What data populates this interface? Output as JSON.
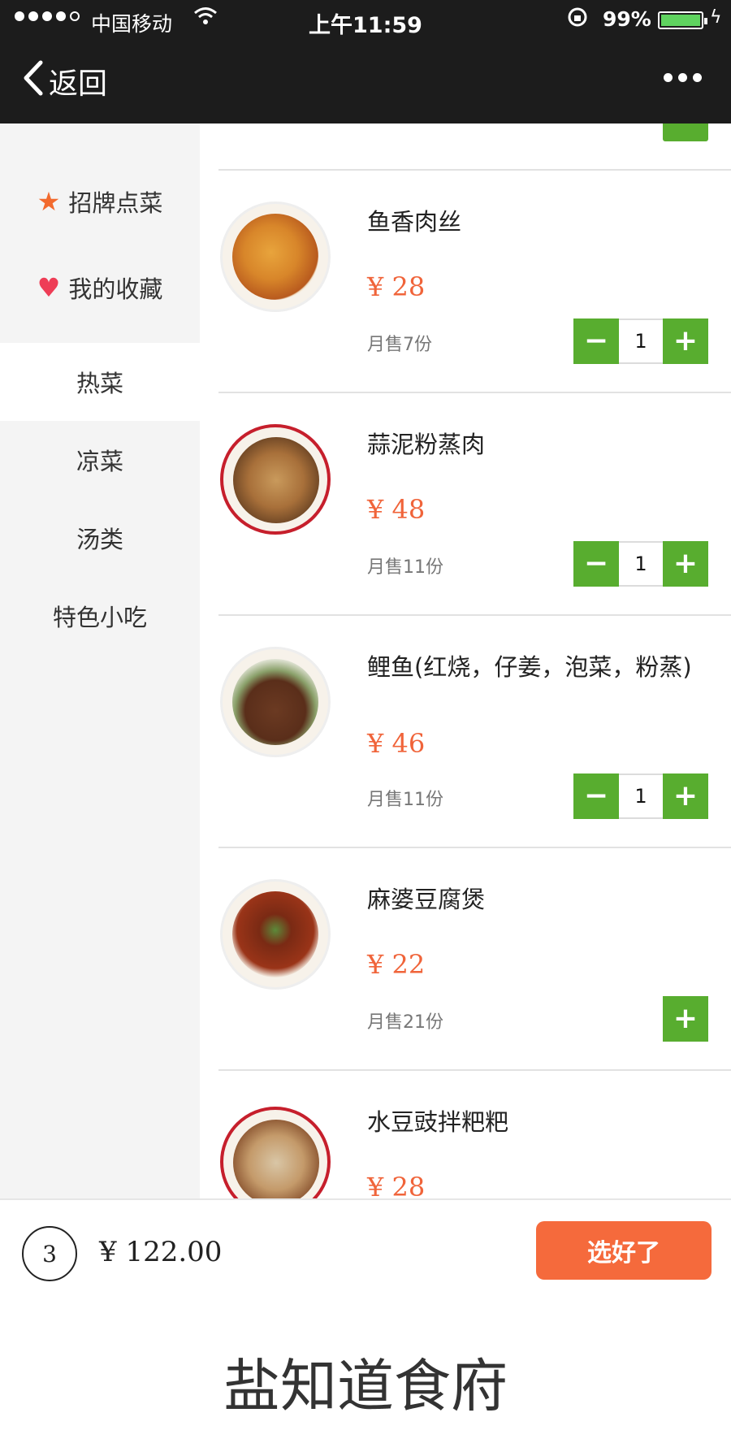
{
  "status_bar": {
    "carrier": "中国移动",
    "time": "上午11:59",
    "battery_percent": "99%",
    "battery_level": 0.99
  },
  "nav": {
    "back_label": "返回"
  },
  "sidebar": {
    "items": [
      {
        "label": "招牌点菜",
        "icon": "star-icon",
        "active": false
      },
      {
        "label": "我的收藏",
        "icon": "heart-icon",
        "active": false
      },
      {
        "label": "热菜",
        "active": true
      },
      {
        "label": "凉菜",
        "active": false
      },
      {
        "label": "汤类",
        "active": false
      },
      {
        "label": "特色小吃",
        "active": false
      }
    ]
  },
  "menu": {
    "items": [
      {
        "name": "鱼香肉丝",
        "price": "¥ 28",
        "sold": "月售7份",
        "qty": "1",
        "has_stepper": true
      },
      {
        "name": "蒜泥粉蒸肉",
        "price": "¥ 48",
        "sold": "月售11份",
        "qty": "1",
        "has_stepper": true
      },
      {
        "name": "鲤鱼(红烧，仔姜，泡菜，粉蒸)",
        "price": "¥ 46",
        "sold": "月售11份",
        "qty": "1",
        "has_stepper": true
      },
      {
        "name": "麻婆豆腐煲",
        "price": "¥ 22",
        "sold": "月售21份",
        "has_stepper": false
      },
      {
        "name": "水豆豉拌粑粑",
        "price": "¥ 28"
      }
    ]
  },
  "cart": {
    "count": "3",
    "total": "¥ 122.00",
    "checkout_label": "选好了"
  },
  "caption": "盐知道食府",
  "colors": {
    "green": "#58ad2f",
    "orange": "#f56a3c",
    "price": "#f0643a",
    "nav_bg": "#1c1c1c"
  }
}
